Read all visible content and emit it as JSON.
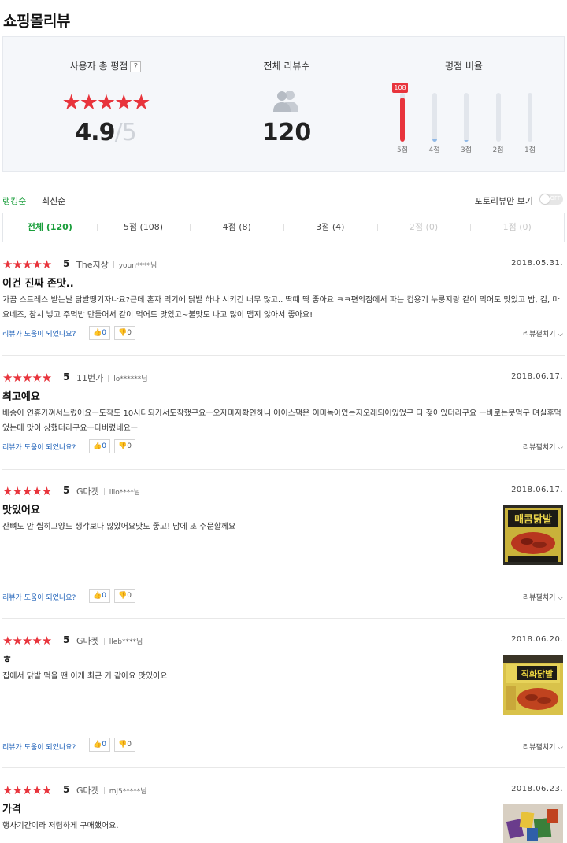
{
  "page_title": "쇼핑몰리뷰",
  "summary": {
    "rating_title": "사용자 총 평점",
    "help_badge": "?",
    "stars": "★★★★★",
    "score": "4.9",
    "slash": "/",
    "score_max": "5",
    "count_title": "전체 리뷰수",
    "count": "120",
    "ratio_title": "평점 비율",
    "ratio_badge": "108",
    "ratio": [
      {
        "label": "5점",
        "count": 108
      },
      {
        "label": "4점",
        "count": 8
      },
      {
        "label": "3점",
        "count": 4
      },
      {
        "label": "2점",
        "count": 0
      },
      {
        "label": "1점",
        "count": 0
      }
    ]
  },
  "sort": {
    "ranking": "랭킹순",
    "latest": "최신순",
    "photo_only": "포토리뷰만 보기",
    "toggle_state": "OFF"
  },
  "tabs": [
    {
      "label": "전체 (120)",
      "state": "active"
    },
    {
      "label": "5점 (108)",
      "state": "normal"
    },
    {
      "label": "4점 (8)",
      "state": "normal"
    },
    {
      "label": "3점 (4)",
      "state": "normal"
    },
    {
      "label": "2점 (0)",
      "state": "disabled"
    },
    {
      "label": "1점 (0)",
      "state": "disabled"
    }
  ],
  "review_ui": {
    "helpful_q": "리뷰가 도움이 되었나요?",
    "up": "👍0",
    "down": "👎0",
    "expand": "리뷰펼치기 ⌵"
  },
  "reviews": [
    {
      "stars": "★★★★★",
      "score": "5",
      "source": "The지상",
      "user": "youn****님",
      "date": "2018.05.31.",
      "title": "이건 진짜 존맛..",
      "body": "가끔 스트레스 받는날 닭발땡기자나요?근데 혼자 먹기에 닭발 하나 시키긴 너무 많고.. 딱떄 딱 좋아요 ㅋㅋ편의점에서 파는 컵용기 누룽지랑 같이 먹어도 맛있고 밥, 김, 마요네즈, 참치 넣고 주먹밥 만들어서 같이 먹어도 맛있고~불맛도 나고 많이 맵지 않아서 좋아요!"
    },
    {
      "stars": "★★★★★",
      "score": "5",
      "source": "11번가",
      "user": "lo******님",
      "date": "2018.06.17.",
      "title": "최고예요",
      "body": "배송이 연휴가껴서느렸어요ㅡ도착도 10시다되가서도착했구요ㅡ오자마자확인하니 아이스팩은 이미녹아있는지오래되어있었구 다 젖어있더라구요 ㅡ바로는못먹구 며실후먹었는데 맛이 상했더라구요ㅡ다버렸네요ㅡ"
    },
    {
      "stars": "★★★★★",
      "score": "5",
      "source": "G마켓",
      "user": "lllo****님",
      "date": "2018.06.17.",
      "title": "맛있어요",
      "body": "잔뼈도 안 씹히고양도 생각보다 많았어요맛도 좋고! 담에 또 주문할께요"
    },
    {
      "stars": "★★★★★",
      "score": "5",
      "source": "G마켓",
      "user": "lleb****님",
      "date": "2018.06.20.",
      "title": "ㅎ",
      "body": "집에서 닭발 먹을 땐 이게 최곤 거 같아요 맛있어요"
    },
    {
      "stars": "★★★★★",
      "score": "5",
      "source": "G마켓",
      "user": "mj5*****님",
      "date": "2018.06.23.",
      "title": "가격",
      "body": "행사기간이라 저렴하게 구매했어요."
    }
  ],
  "thumb_labels": [
    "매콤닭발",
    "직화닭발"
  ]
}
